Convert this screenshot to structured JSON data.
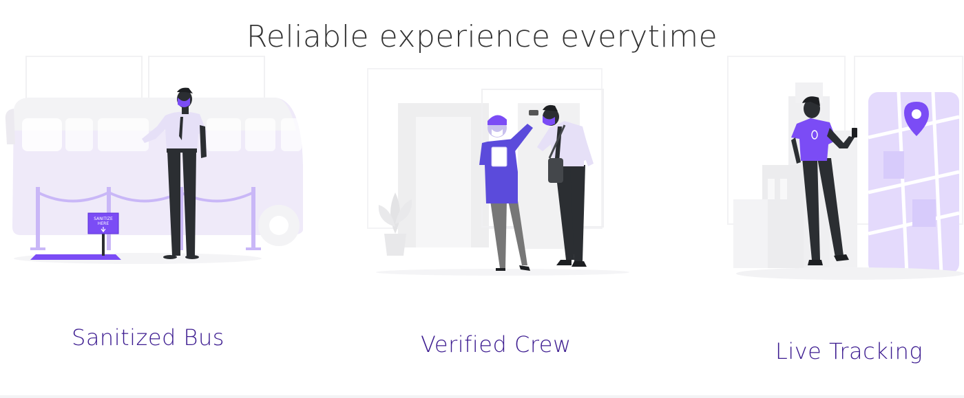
{
  "page": {
    "title": "Reliable experience everytime"
  },
  "features": [
    {
      "label": "Sanitized Bus",
      "illustration": "sanitized-bus-illustration",
      "sign_text_1": "SANITIZE",
      "sign_text_2": "HERE"
    },
    {
      "label": "Verified Crew",
      "illustration": "verified-crew-illustration"
    },
    {
      "label": "Live Tracking",
      "illustration": "live-tracking-illustration"
    }
  ],
  "colors": {
    "accent": "#7b4cf5",
    "accent_light": "#e9e1fd",
    "label": "#3b1a8f",
    "title": "#333333",
    "skin": "#2b2e32"
  }
}
